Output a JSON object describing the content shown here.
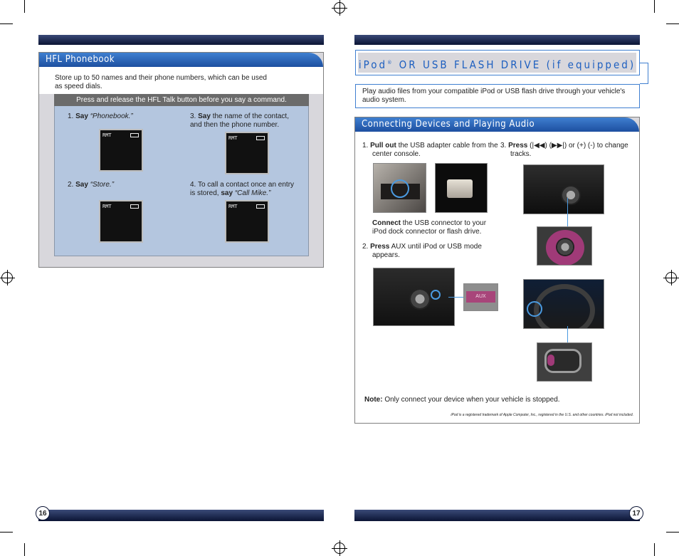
{
  "left_page": {
    "page_number": "16",
    "section_title": "HFL Phonebook",
    "intro": "Store up to 50 names and their phone numbers, which can be used as speed dials.",
    "instruction_bar": "Press and release the HFL Talk button before you say a command.",
    "steps": [
      {
        "num": "1.",
        "verb": "Say",
        "text": " “Phonebook.”",
        "screen_status": "RMT"
      },
      {
        "num": "2.",
        "verb": "Say",
        "text": " “Store.”",
        "screen_status": "RMT"
      },
      {
        "num": "3.",
        "verb": "Say",
        "text": " the name of the contact, and then the phone number.",
        "screen_status": "RMT"
      },
      {
        "num": "4.",
        "pre": "To call a contact once an entry is stored, ",
        "verb": "say",
        "text": " “Call Mike.”",
        "screen_status": "RMT"
      }
    ]
  },
  "right_page": {
    "page_number": "17",
    "header_title": "iPod",
    "header_reg": "®",
    "header_rest": " OR USB FLASH DRIVE (if equipped)",
    "intro": "Play audio files from your compatible iPod or USB flash drive through your vehicle's audio system.",
    "section_title": "Connecting Devices and Playing Audio",
    "step1_num": "1.",
    "step1_verb": "Pull out",
    "step1_text": " the USB adapter cable from the center console.",
    "connect_verb": "Connect",
    "connect_text": " the USB connector to your iPod dock connector or flash drive.",
    "step2_num": "2.",
    "step2_verb": "Press",
    "step2_text": " AUX until iPod or USB mode appears.",
    "aux_label": "AUX",
    "step3_num": "3.",
    "step3_verb": "Press",
    "step3_text": " (|◀◀) (▶▶|) or (+) (-) to change tracks.",
    "note_label": "Note:",
    "note_text": " Only connect your device when your vehicle is stopped.",
    "trademark": "iPod is a registered trademark of Apple Computer, Inc., registered in the U.S. and other countries. iPod not included."
  }
}
